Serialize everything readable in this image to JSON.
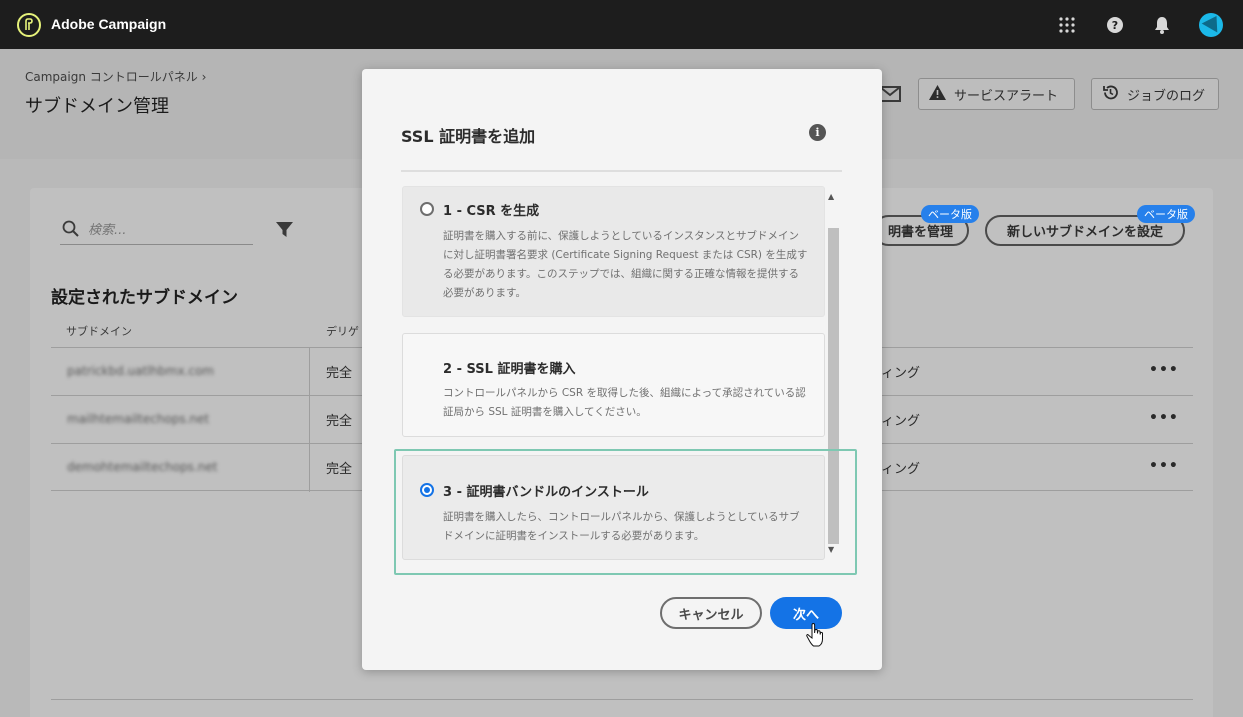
{
  "topbar": {
    "app_title": "Adobe Campaign"
  },
  "header": {
    "breadcrumb": "Campaign コントロールパネル",
    "page_title": "サブドメイン管理",
    "service_alert_label": "サービスアラート",
    "job_log_label": "ジョブのログ"
  },
  "main": {
    "search_placeholder": "検索...",
    "section_title": "設定されたサブドメイン",
    "columns": [
      "サブドメイン",
      "デリゲ"
    ],
    "rows": [
      {
        "subdomain": "patrickbd.uatlhbmx.com",
        "delegation": "完全",
        "status": "ィング"
      },
      {
        "subdomain": "mailhtemailtechops.net",
        "delegation": "完全",
        "status": "ィング"
      },
      {
        "subdomain": "demohtemailtechops.net",
        "delegation": "完全",
        "status": "ィング"
      }
    ],
    "more_label": "•••",
    "manage_cert_label": "明書を管理",
    "new_subdomain_label": "新しいサブドメインを設定",
    "beta_label": "ベータ版"
  },
  "modal": {
    "title": "SSL 証明書を追加",
    "info_icon": "i",
    "options": [
      {
        "title": "1 - CSR を生成",
        "desc": "証明書を購入する前に、保護しようとしているインスタンスとサブドメインに対し証明書署名要求 (Certificate Signing Request または CSR) を生成する必要があります。このステップでは、組織に関する正確な情報を提供する必要があります。"
      },
      {
        "title": "2 - SSL 証明書を購入",
        "desc": "コントロールパネルから CSR を取得した後、組織によって承認されている認証局から SSL 証明書を購入してください。"
      },
      {
        "title": "3 - 証明書バンドルのインストール",
        "desc": "証明書を購入したら、コントロールパネルから、保護しようとしているサブドメインに証明書をインストールする必要があります。"
      }
    ],
    "selected_option": 3,
    "cancel_label": "キャンセル",
    "next_label": "次へ"
  },
  "colors": {
    "accent": "#1473e6",
    "beta": "#2680eb",
    "highlight": "#7ec8b2"
  }
}
